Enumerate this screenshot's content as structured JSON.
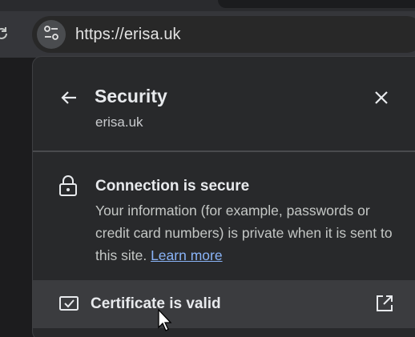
{
  "browser": {
    "url": "https://erisa.uk",
    "icons": {
      "reload": "reload-icon",
      "site_info": "tune-icon"
    }
  },
  "security_panel": {
    "title": "Security",
    "subtitle": "erisa.uk",
    "connection": {
      "title": "Connection is secure",
      "description": "Your information (for example, passwords or credit card numbers) is private when it is sent to this site.",
      "link_label": "Learn more"
    },
    "certificate": {
      "label": "Certificate is valid"
    },
    "icons": {
      "back": "arrow-left-icon",
      "close": "close-icon",
      "lock": "lock-icon",
      "certificate": "certificate-icon",
      "open_external": "open-in-new-icon"
    }
  },
  "colors": {
    "panel_bg": "#28292b",
    "highlight_row": "#3b3c3f",
    "link": "#8ab4f8",
    "text": "#e8eaed"
  }
}
